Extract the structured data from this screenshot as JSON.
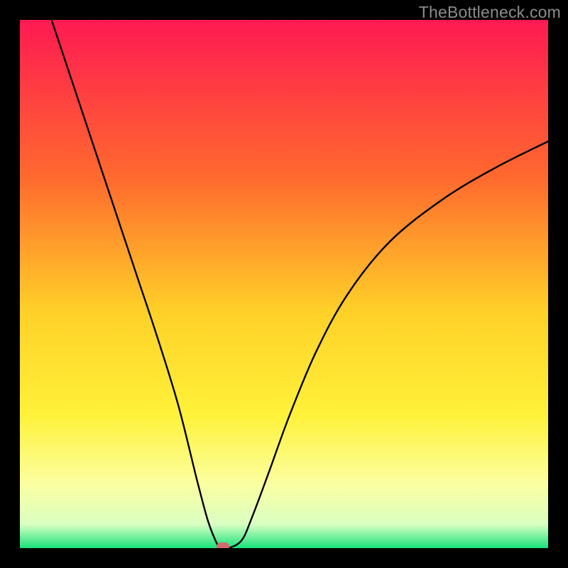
{
  "watermark": "TheBottleneck.com",
  "chart_data": {
    "type": "line",
    "title": "",
    "xlabel": "",
    "ylabel": "",
    "x_range": [
      0,
      1
    ],
    "y_range": [
      0,
      1
    ],
    "series": [
      {
        "name": "curve",
        "x": [
          0.06,
          0.1,
          0.14,
          0.18,
          0.22,
          0.26,
          0.3,
          0.335,
          0.355,
          0.37,
          0.38,
          0.395,
          0.42,
          0.44,
          0.47,
          0.51,
          0.56,
          0.62,
          0.7,
          0.8,
          0.9,
          1.0
        ],
        "y": [
          1.0,
          0.88,
          0.76,
          0.64,
          0.52,
          0.4,
          0.27,
          0.13,
          0.055,
          0.015,
          0.0,
          0.0,
          0.015,
          0.06,
          0.14,
          0.25,
          0.37,
          0.48,
          0.58,
          0.66,
          0.72,
          0.77
        ]
      }
    ],
    "minimum_point": {
      "x": 0.384,
      "y": 0.0
    },
    "gradient_stops": [
      {
        "offset": 0.0,
        "color": "#ff1a52"
      },
      {
        "offset": 0.3,
        "color": "#ff6a2e"
      },
      {
        "offset": 0.55,
        "color": "#ffd028"
      },
      {
        "offset": 0.75,
        "color": "#fff23a"
      },
      {
        "offset": 0.88,
        "color": "#fbffa2"
      },
      {
        "offset": 0.955,
        "color": "#d9ffc2"
      },
      {
        "offset": 1.0,
        "color": "#18e27a"
      }
    ]
  }
}
